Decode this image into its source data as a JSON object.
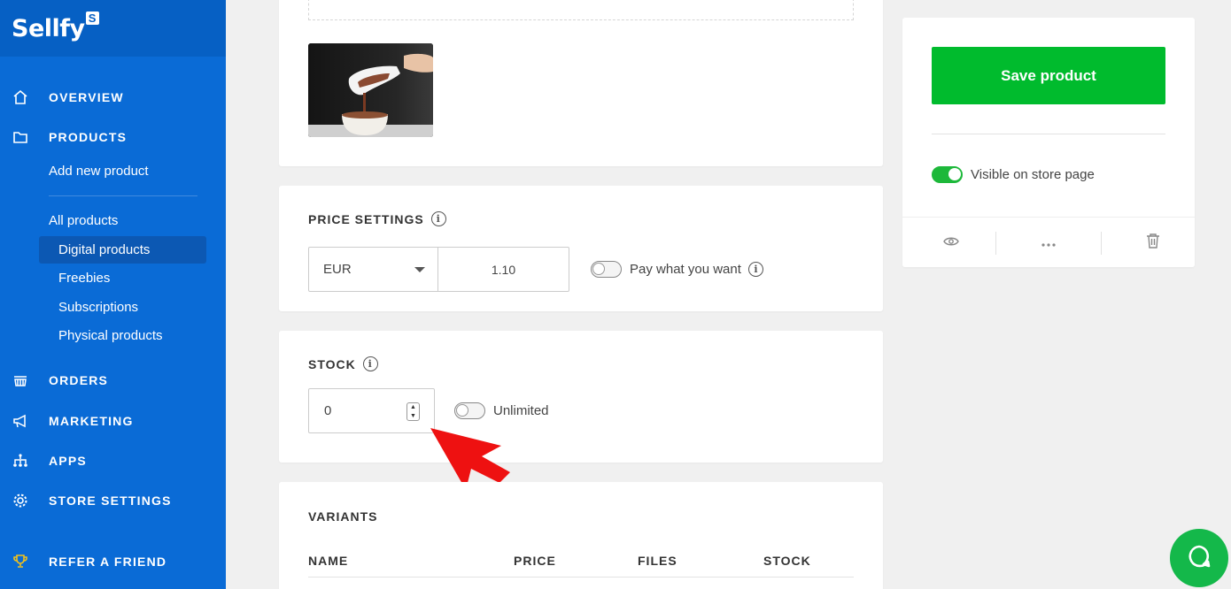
{
  "brand": {
    "name": "Sellfy",
    "badge": "S"
  },
  "nav": {
    "overview": "OVERVIEW",
    "products": "PRODUCTS",
    "add_new_product": "Add new product",
    "all_products": "All products",
    "digital_products": "Digital products",
    "freebies": "Freebies",
    "subscriptions": "Subscriptions",
    "physical_products": "Physical products",
    "orders": "ORDERS",
    "marketing": "MARKETING",
    "apps": "APPS",
    "store_settings": "STORE SETTINGS",
    "refer_a_friend": "REFER A FRIEND"
  },
  "price_settings": {
    "title": "PRICE SETTINGS",
    "currency": "EUR",
    "price": "1.10",
    "pay_what_you_want_label": "Pay what you want",
    "pay_what_you_want_enabled": false
  },
  "stock": {
    "title": "STOCK",
    "value": "0",
    "unlimited_label": "Unlimited",
    "unlimited_enabled": false
  },
  "variants": {
    "title": "VARIANTS",
    "columns": [
      "NAME",
      "PRICE",
      "FILES",
      "STOCK"
    ]
  },
  "sidebar_panel": {
    "save_label": "Save product",
    "visible_label": "Visible on store page",
    "visible_enabled": true
  },
  "colors": {
    "sidebar": "#0a6bd6",
    "save_button": "#00bb2d",
    "toggle_on": "#1db83a",
    "annotation_arrow": "#ee1111"
  },
  "icons": [
    "home-icon",
    "folder-icon",
    "basket-icon",
    "megaphone-icon",
    "sitemap-icon",
    "gear-icon",
    "trophy-icon",
    "info-icon",
    "eye-icon",
    "more-icon",
    "trash-icon",
    "chat-icon"
  ]
}
